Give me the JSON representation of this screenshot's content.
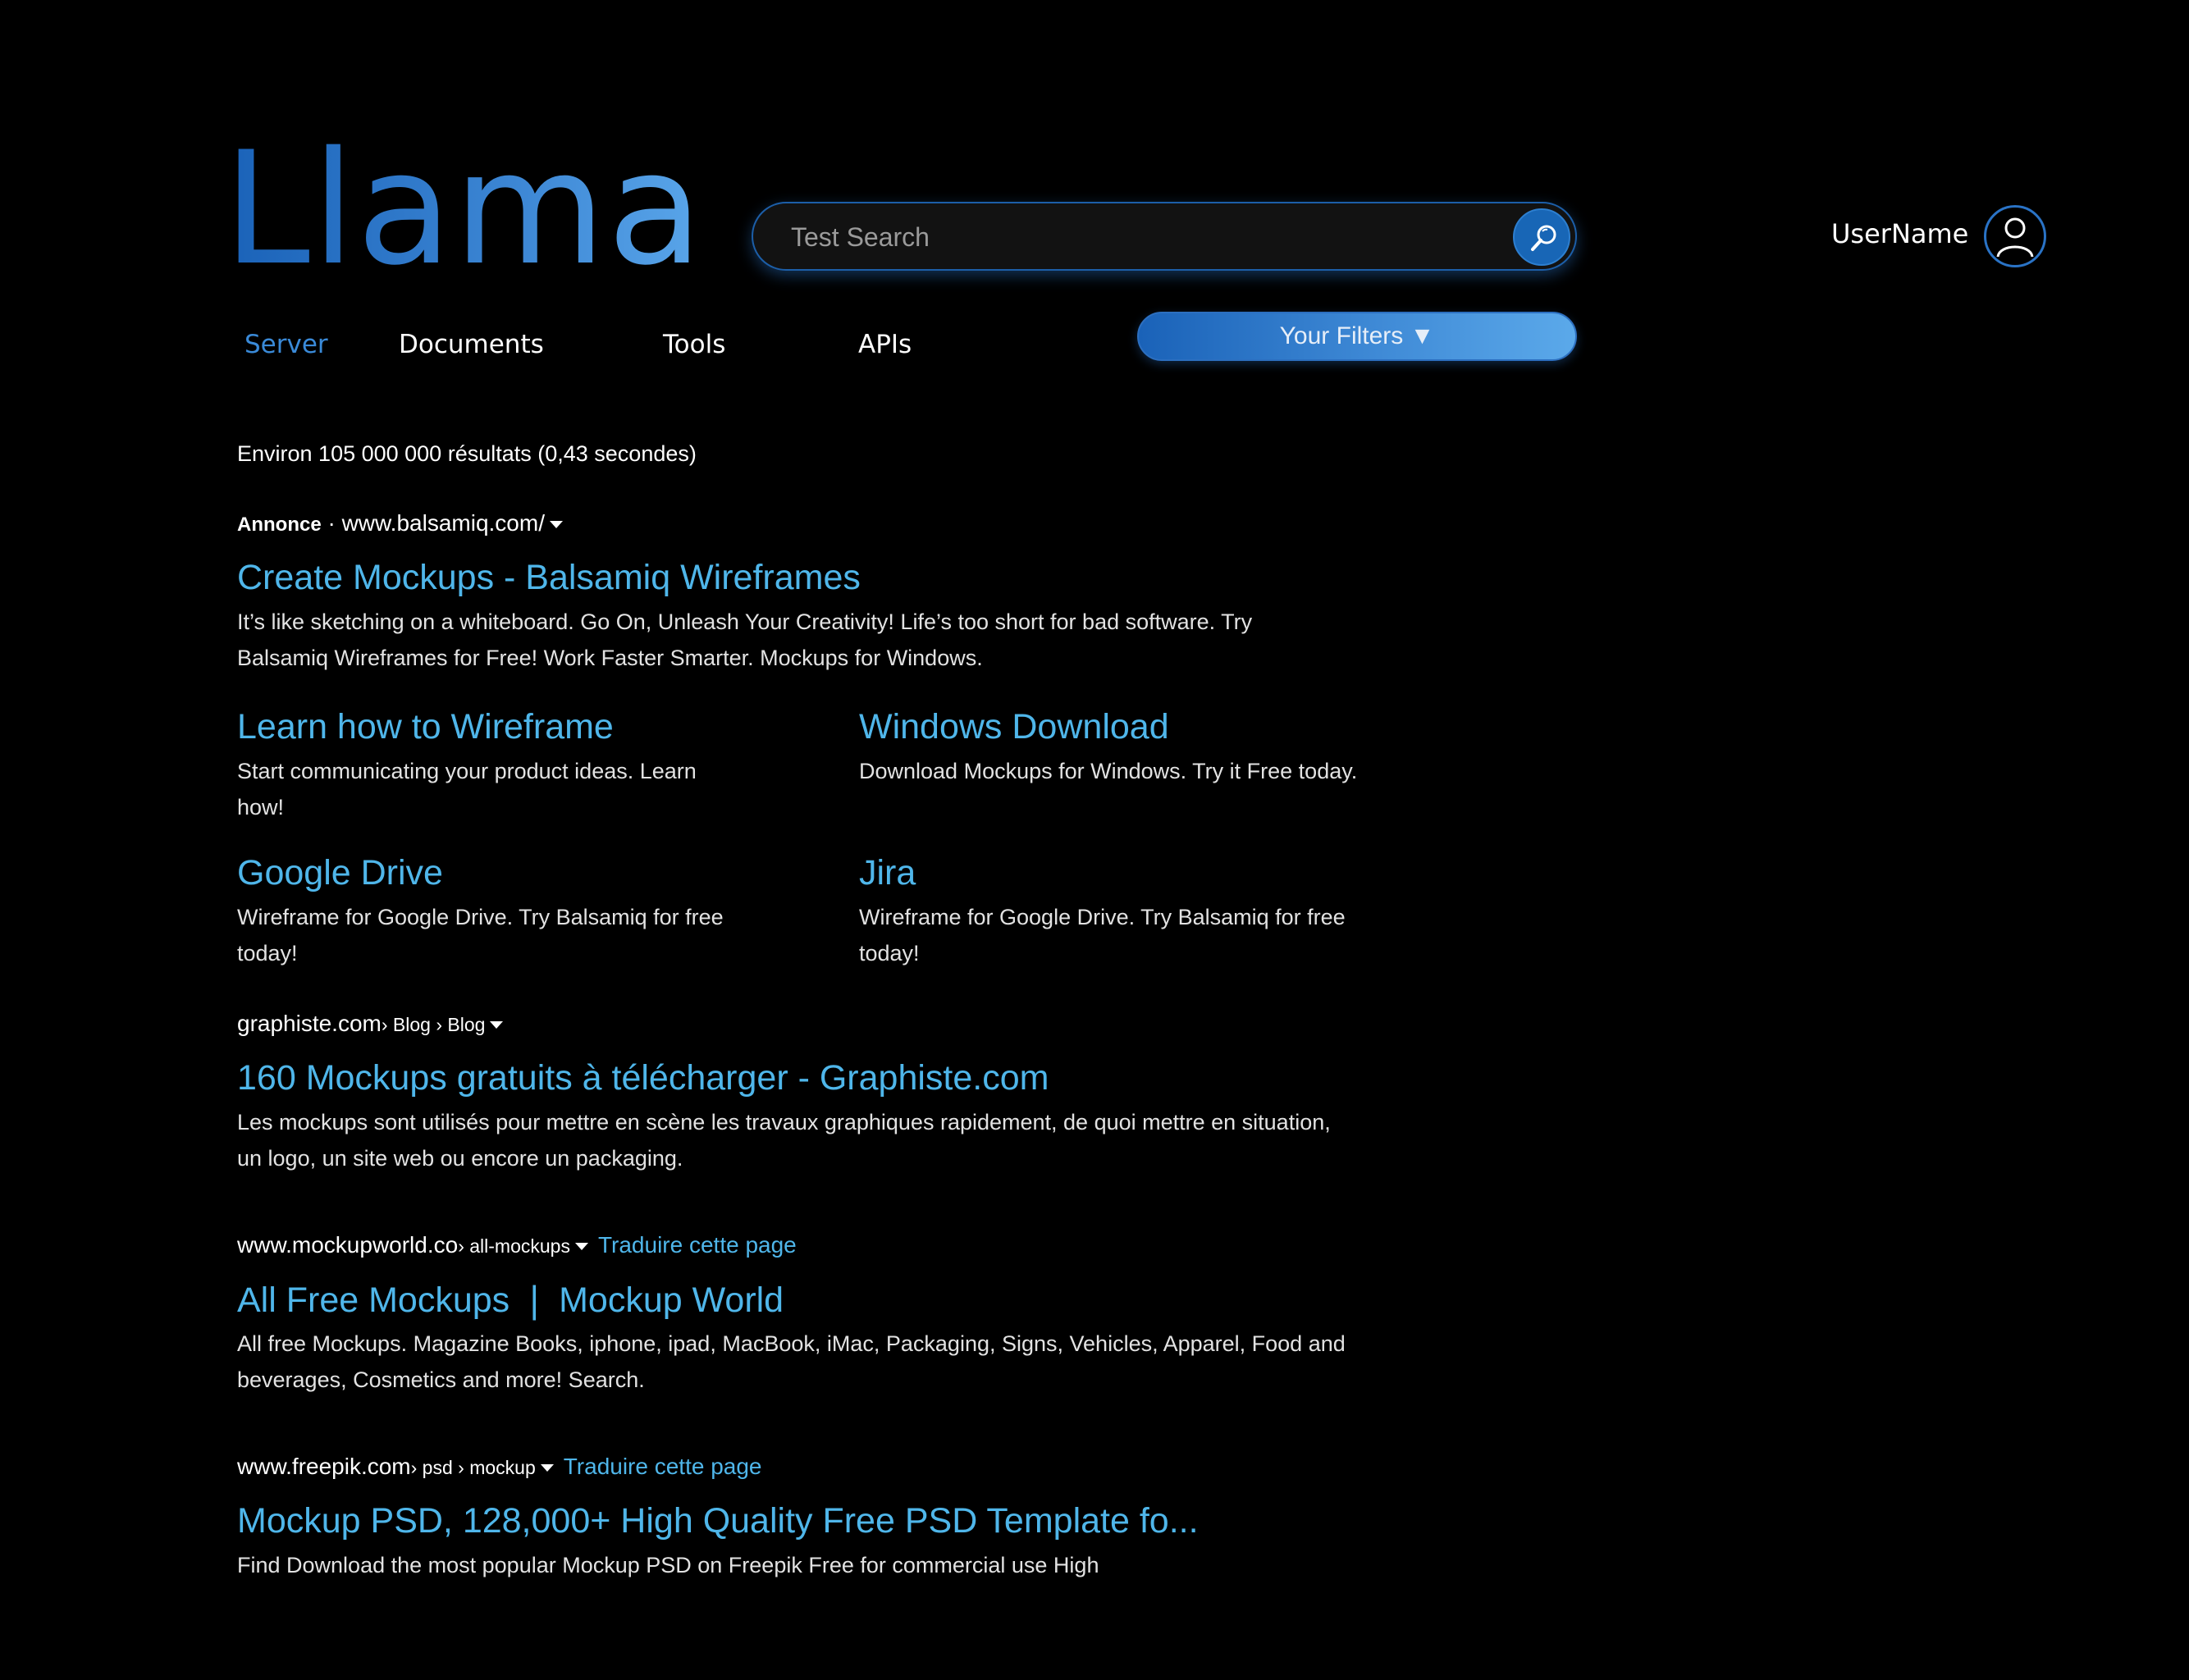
{
  "logo": "Llama",
  "search": {
    "placeholder": "Test Search"
  },
  "user": {
    "name": "UserName"
  },
  "nav": [
    "Server",
    "Documents",
    "Tools",
    "APIs"
  ],
  "filters_label": "Your Filters ▼",
  "stats": "Environ 105 000 000 résultats (0,43 secondes)",
  "ad": {
    "label": "Annonce",
    "url": "www.balsamiq.com/",
    "title": "Create Mockups - Balsamiq Wireframes",
    "desc": "It’s like sketching on a whiteboard. Go On, Unleash Your Creativity! Life’s too short for bad software. Try Balsamiq Wireframes for Free! Work Faster Smarter. Mockups for Windows.",
    "sitelinks": [
      {
        "title": "Learn how to Wireframe",
        "desc": "Start communicating your product ideas. Learn how!"
      },
      {
        "title": "Windows Download",
        "desc": "Download Mockups for Windows. Try it Free today."
      },
      {
        "title": "Google Drive",
        "desc": "Wireframe for Google Drive. Try Balsamiq for free today!"
      },
      {
        "title": "Jira",
        "desc": "Wireframe for Google Drive. Try Balsamiq for free today!"
      }
    ]
  },
  "results": [
    {
      "domain": "graphiste.com",
      "path": "› Blog › Blog",
      "translate": "",
      "title": "160 Mockups gratuits à télécharger - Graphiste.com",
      "desc": "Les mockups sont utilisés pour mettre en scène les travaux graphiques rapidement, de quoi mettre en situation, un logo, un site web ou encore un packaging."
    },
    {
      "domain": "www.mockupworld.co",
      "path": "› all-mockups",
      "translate": "Traduire cette page",
      "title": "All Free Mockups ❘ Mockup World",
      "desc": "All free Mockups. Magazine Books, iphone, ipad, MacBook, iMac, Packaging, Signs, Vehicles, Apparel, Food and beverages, Cosmetics and more! Search."
    },
    {
      "domain": "www.freepik.com",
      "path": "› psd › mockup",
      "translate": "Traduire cette page",
      "title": "Mockup PSD, 128,000+ High Quality Free PSD Template fo...",
      "desc": "Find Download the most popular Mockup PSD on Freepik Free for commercial use High"
    }
  ],
  "colors": {
    "accent": "#1a62b8",
    "link": "#4fb6ea",
    "background": "#000000"
  },
  "icons": {
    "search": "magnifier-icon",
    "user": "user-icon",
    "dropdown": "caret-down-icon"
  }
}
